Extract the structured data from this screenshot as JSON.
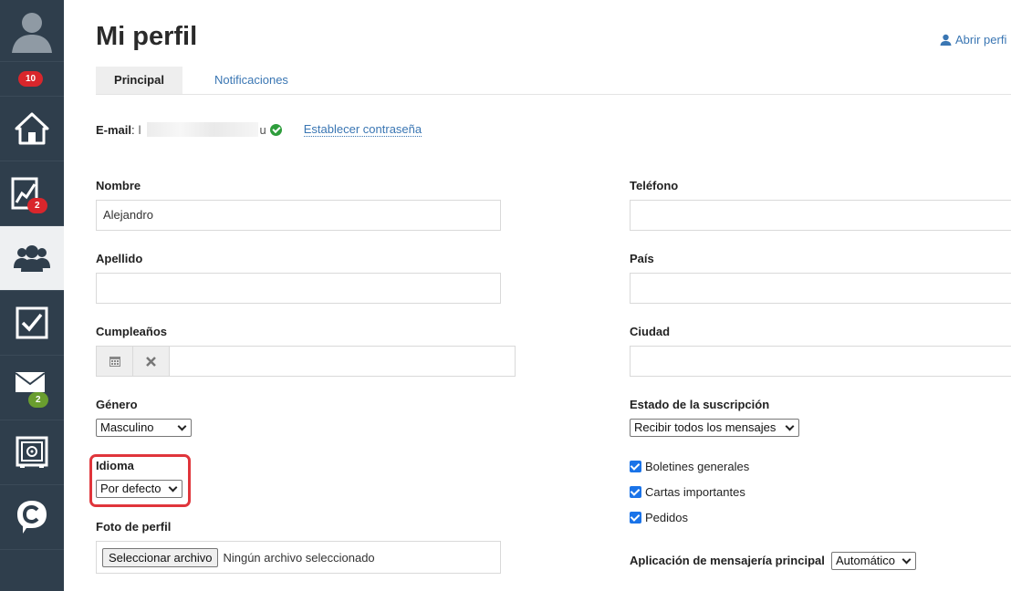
{
  "sidebar": {
    "notifications_badge": "10",
    "reports_badge": "2",
    "mail_badge": "2",
    "items": [
      "avatar-icon",
      "home-icon",
      "reports-icon",
      "contacts-icon",
      "tasks-icon",
      "mail-icon",
      "safe-icon",
      "chat-icon"
    ]
  },
  "header": {
    "title": "Mi perfil",
    "open_profile": "Abrir perfi"
  },
  "tabs": [
    {
      "label": "Principal",
      "active": true
    },
    {
      "label": "Notificaciones",
      "active": false
    }
  ],
  "email": {
    "label": "E-mail",
    "value_start": "l",
    "value_end": "u",
    "set_password_link": "Establecer contraseña"
  },
  "form": {
    "nombre_label": "Nombre",
    "nombre_value": "Alejandro",
    "apellido_label": "Apellido",
    "apellido_value": "",
    "cumpleanos_label": "Cumpleaños",
    "cumpleanos_value": "",
    "genero_label": "Género",
    "genero_value": "Masculino",
    "idioma_label": "Idioma",
    "idioma_value": "Por defecto",
    "foto_label": "Foto de perfil",
    "foto_button": "Seleccionar archivo",
    "foto_status": "Ningún archivo seleccionado",
    "telefono_label": "Teléfono",
    "telefono_value": "",
    "pais_label": "País",
    "pais_value": "",
    "ciudad_label": "Ciudad",
    "ciudad_value": "",
    "suscripcion_label": "Estado de la suscripción",
    "suscripcion_value": "Recibir todos los mensajes",
    "checkboxes": [
      {
        "label": "Boletines generales",
        "checked": true
      },
      {
        "label": "Cartas importantes",
        "checked": true
      },
      {
        "label": "Pedidos",
        "checked": true
      }
    ],
    "mensajeria_label": "Aplicación de mensajería principal",
    "mensajeria_value": "Automático"
  },
  "colors": {
    "sidebar_bg": "#2f3e4c",
    "link": "#3a76b3",
    "badge_red": "#d9262c",
    "badge_green": "#6a9e2f",
    "highlight": "#e0353b"
  }
}
